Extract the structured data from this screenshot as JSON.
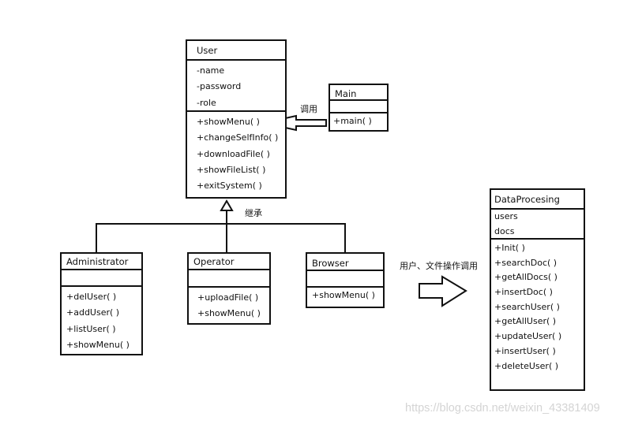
{
  "classes": {
    "user": {
      "name": "User",
      "attributes": [
        "-name",
        "-password",
        "-role"
      ],
      "methods": [
        "+showMenu( )",
        "+changeSelfInfo( )",
        "+downloadFile( )",
        "+showFileList( )",
        "+exitSystem( )"
      ]
    },
    "main": {
      "name": "Main",
      "attributes": [],
      "methods": [
        "+main( )"
      ]
    },
    "administrator": {
      "name": "Administrator",
      "attributes": [],
      "methods": [
        "+delUser( )",
        "+addUser( )",
        "+listUser( )",
        "+showMenu( )"
      ]
    },
    "operator": {
      "name": "Operator",
      "attributes": [],
      "methods": [
        "+uploadFile( )",
        "+showMenu( )"
      ]
    },
    "browser": {
      "name": "Browser",
      "attributes": [],
      "methods": [
        "+showMenu( )"
      ]
    },
    "dataprocessing": {
      "name": "DataProcesing",
      "attributes": [
        "users",
        "docs"
      ],
      "methods": [
        "+Init( )",
        "+searchDoc( )",
        "+getAllDocs( )",
        "+insertDoc( )",
        "+searchUser( )",
        "+getAllUser( )",
        "+updateUser( )",
        "+insertUser( )",
        "+deleteUser( )"
      ]
    }
  },
  "labels": {
    "call": "调用",
    "inherit": "继承",
    "data_call": "用户、文件操作调用"
  },
  "watermark": "https://blog.csdn.net/weixin_43381409"
}
